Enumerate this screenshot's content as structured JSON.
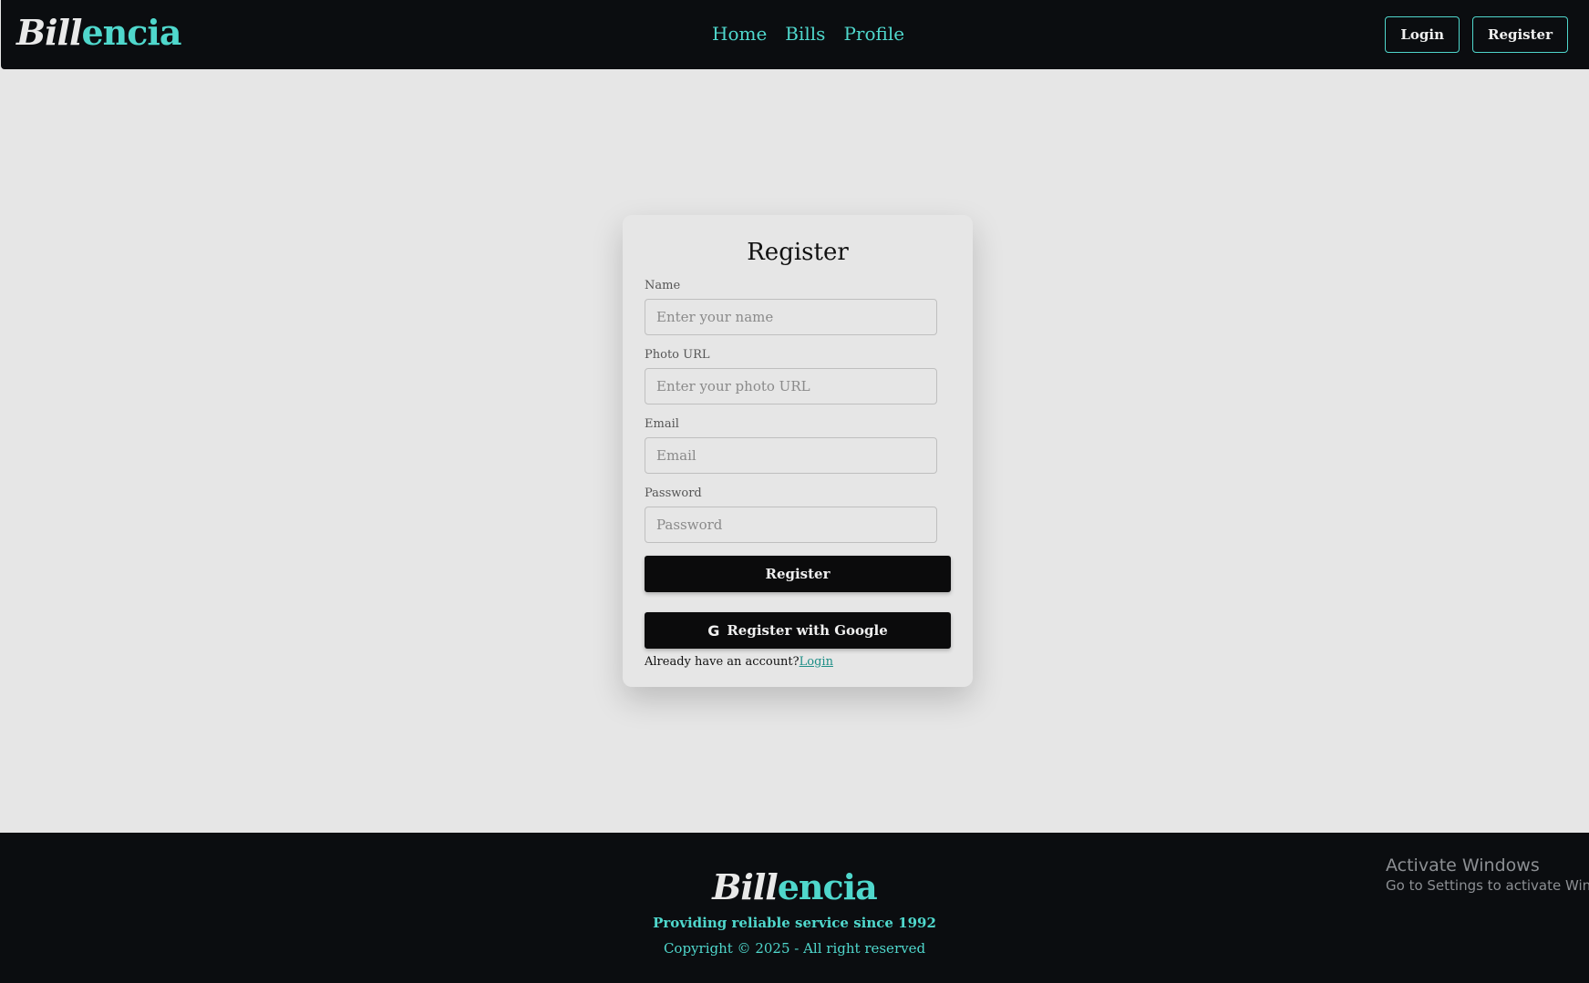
{
  "brand": {
    "part1": "Bill",
    "part2": "encia"
  },
  "nav": {
    "links": [
      "Home",
      "Bills",
      "Profile"
    ],
    "login_label": "Login",
    "register_label": "Register"
  },
  "form": {
    "title": "Register",
    "fields": [
      {
        "label": "Name",
        "placeholder": "Enter your name"
      },
      {
        "label": "Photo URL",
        "placeholder": "Enter your photo URL"
      },
      {
        "label": "Email",
        "placeholder": "Email"
      },
      {
        "label": "Password",
        "placeholder": "Password"
      }
    ],
    "submit_label": "Register",
    "google_label": "Register with Google",
    "google_icon": "google-icon",
    "switch_text": "Already have an account?",
    "switch_link": "Login"
  },
  "footer": {
    "tagline": "Providing reliable service since 1992",
    "copyright": "Copyright © 2025 - All right reserved"
  },
  "watermark": {
    "title": "Activate Windows",
    "subtitle": "Go to Settings to activate Windows."
  },
  "colors": {
    "accent": "#4fd7cc",
    "dark": "#0b0d10",
    "background": "#e6e6e6"
  }
}
